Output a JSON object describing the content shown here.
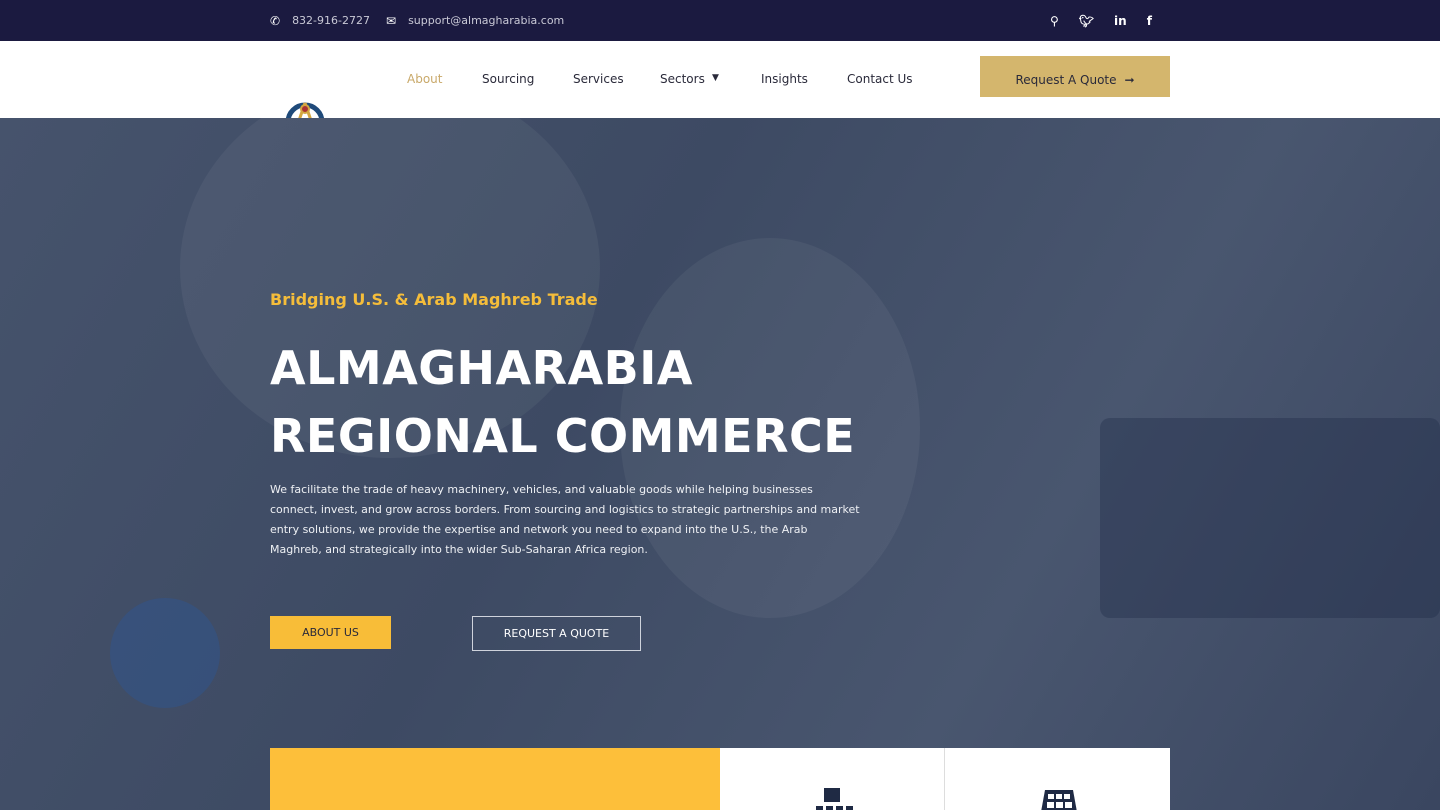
{
  "topbar": {
    "phone": "832-916-2727",
    "email": "support@almagharabia.com",
    "icons": [
      "search-icon",
      "twitter-icon",
      "linkedin-icon",
      "facebook-icon"
    ]
  },
  "nav": {
    "items": [
      {
        "label": "About",
        "active": true
      },
      {
        "label": "Sourcing"
      },
      {
        "label": "Services"
      },
      {
        "label": "Sectors"
      },
      {
        "label": "Insights"
      },
      {
        "label": "Contact Us"
      }
    ],
    "cta": "Request A Quote",
    "active_color": "#c9a96a"
  },
  "hero": {
    "subtitle": "Bridging U.S. & Arab Maghreb Trade",
    "title_line1": "ALMAGHARABIA",
    "title_line2": "REGIONAL COMMERCE",
    "description": "We facilitate the trade of heavy machinery, vehicles, and valuable goods while helping businesses connect, invest, and grow across borders. From sourcing and logistics to strategic partnerships and market entry solutions, we provide the expertise and network you need to expand into the U.S., the Arab Maghreb, and strategically into the wider Sub-Saharan Africa region.",
    "btn_about": "ABOUT US",
    "btn_quote": "REQUEST A QUOTE"
  },
  "colors": {
    "topbar": "#1b1a40",
    "accent": "#f8bd38",
    "gold": "#d4b66d"
  }
}
